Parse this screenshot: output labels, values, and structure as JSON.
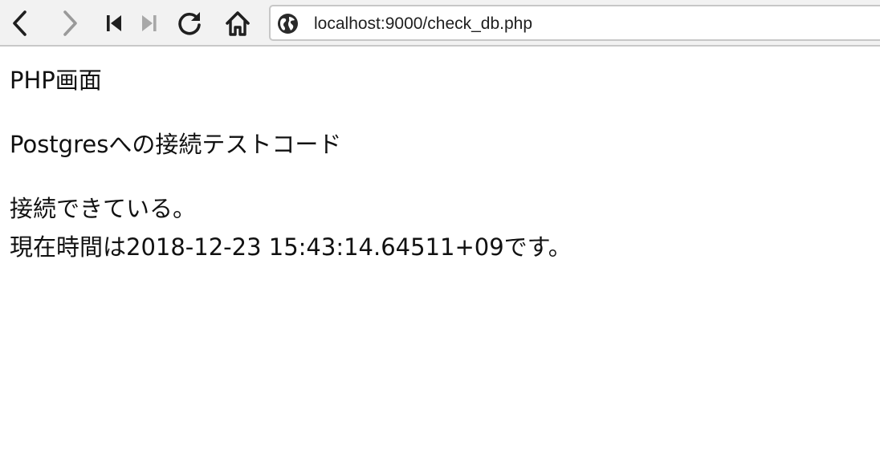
{
  "browser": {
    "url": "localhost:9000/check_db.php",
    "icons": [
      "back-icon",
      "forward-icon",
      "first-page-icon",
      "last-page-icon",
      "reload-icon",
      "home-icon",
      "globe-icon"
    ],
    "colors": {
      "toolbar_bg": "#f2f2f2",
      "icon_active": "#1f1f1f",
      "icon_disabled": "#9a9a9a"
    }
  },
  "page": {
    "heading": "PHP画面",
    "subheading": "Postgresへの接続テストコード",
    "status": "接続できている。",
    "time_message": "現在時間は2018-12-23 15:43:14.64511+09です。"
  }
}
